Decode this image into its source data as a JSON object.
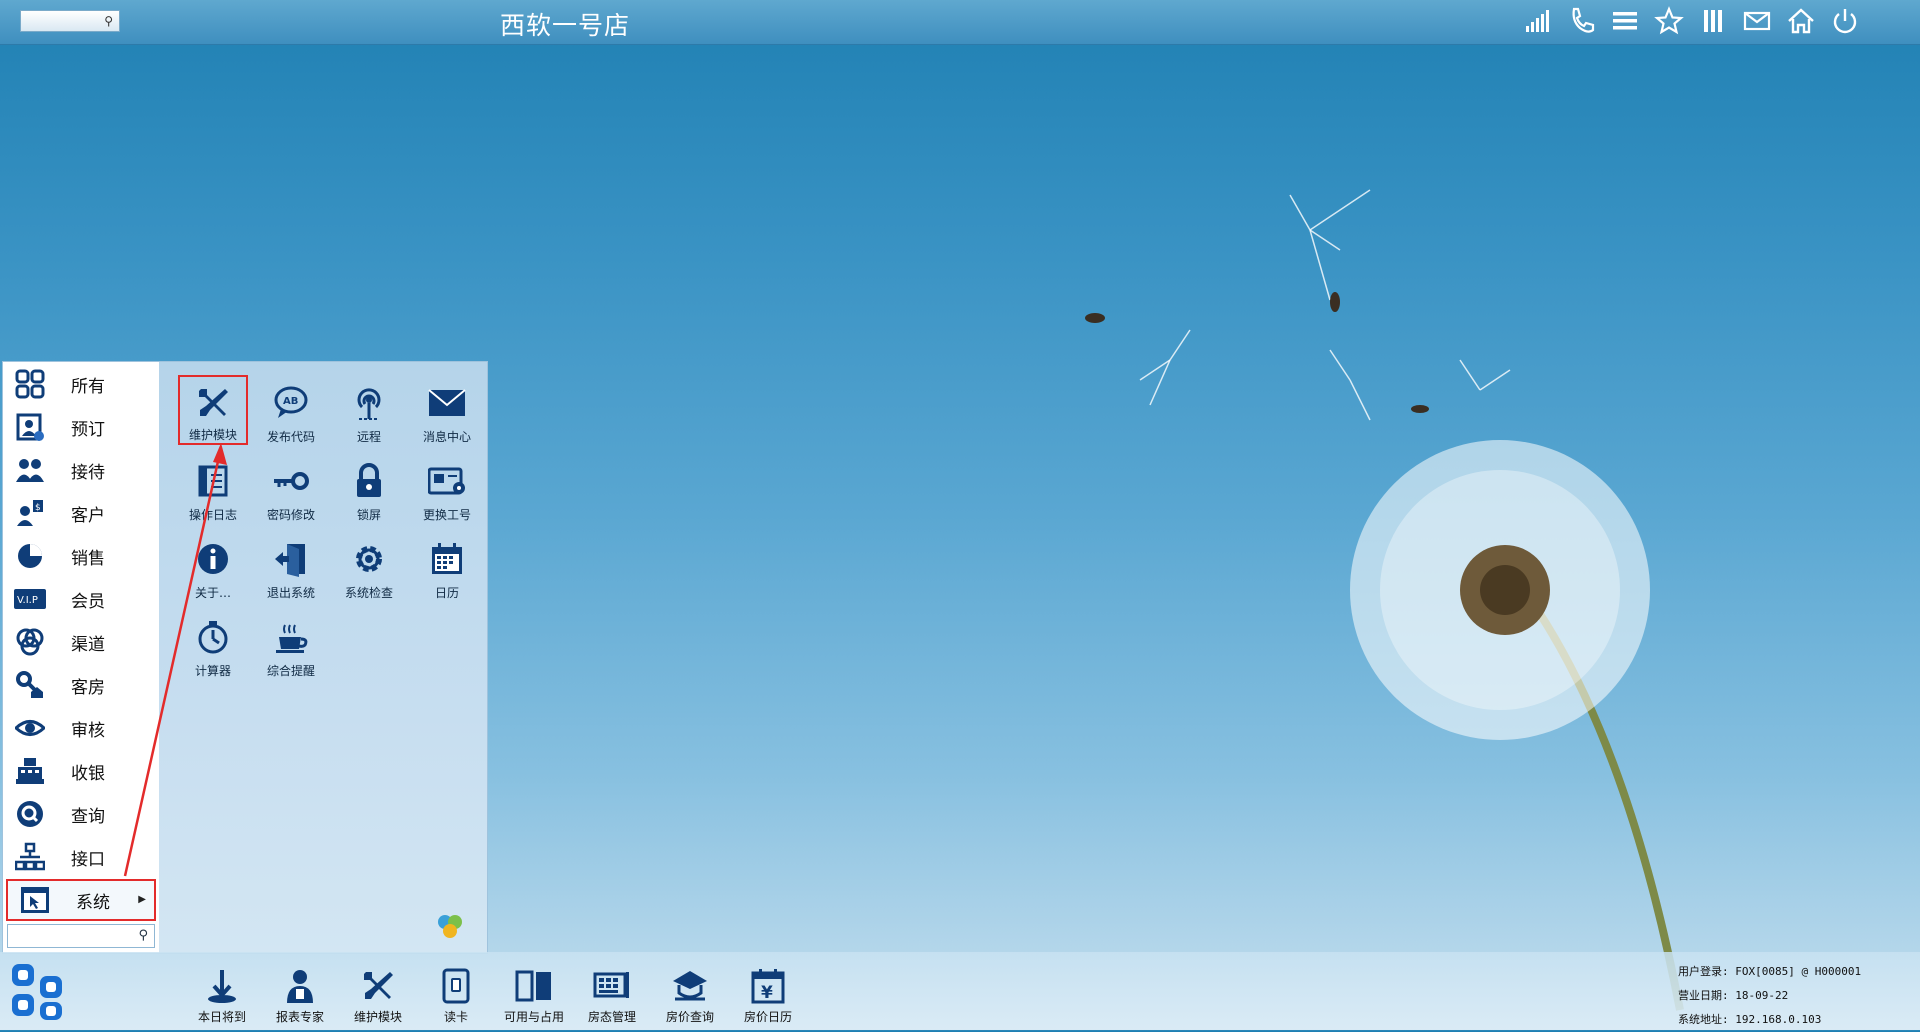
{
  "app": {
    "title": "西软一号店"
  },
  "top_search": {
    "placeholder": ""
  },
  "top_icons": [
    {
      "name": "signal-icon"
    },
    {
      "name": "phone-icon"
    },
    {
      "name": "menu-list-icon"
    },
    {
      "name": "star-icon"
    },
    {
      "name": "columns-icon"
    },
    {
      "name": "mail-icon"
    },
    {
      "name": "home-icon"
    },
    {
      "name": "power-icon"
    }
  ],
  "menu": {
    "categories": [
      {
        "label": "所有",
        "icon": "grid-icon"
      },
      {
        "label": "预订",
        "icon": "booking-icon"
      },
      {
        "label": "接待",
        "icon": "reception-icon"
      },
      {
        "label": "客户",
        "icon": "customer-icon"
      },
      {
        "label": "销售",
        "icon": "sales-icon"
      },
      {
        "label": "会员",
        "icon": "vip-icon"
      },
      {
        "label": "渠道",
        "icon": "channel-icon"
      },
      {
        "label": "客房",
        "icon": "room-icon"
      },
      {
        "label": "审核",
        "icon": "eye-icon"
      },
      {
        "label": "收银",
        "icon": "cashier-icon"
      },
      {
        "label": "查询",
        "icon": "search-icon"
      },
      {
        "label": "接口",
        "icon": "interface-icon"
      },
      {
        "label": "系统",
        "icon": "system-icon",
        "active": true
      }
    ],
    "tiles": [
      {
        "label": "维护模块",
        "icon": "wrench-icon",
        "highlighted": true
      },
      {
        "label": "发布代码",
        "icon": "speech-code-icon"
      },
      {
        "label": "远程",
        "icon": "antenna-icon"
      },
      {
        "label": "消息中心",
        "icon": "envelope-icon"
      },
      {
        "label": "操作日志",
        "icon": "logbook-icon"
      },
      {
        "label": "密码修改",
        "icon": "key-icon"
      },
      {
        "label": "锁屏",
        "icon": "lock-icon"
      },
      {
        "label": "更换工号",
        "icon": "id-card-icon"
      },
      {
        "label": "关于…",
        "icon": "info-icon"
      },
      {
        "label": "退出系统",
        "icon": "exit-icon"
      },
      {
        "label": "系统检查",
        "icon": "gear-check-icon"
      },
      {
        "label": "日历",
        "icon": "calendar-icon"
      },
      {
        "label": "计算器",
        "icon": "stopwatch-icon"
      },
      {
        "label": "综合提醒",
        "icon": "coffee-icon"
      }
    ],
    "search_placeholder": ""
  },
  "taskbar": {
    "buttons": [
      {
        "label": "本日将到",
        "icon": "arrival-icon"
      },
      {
        "label": "报表专家",
        "icon": "report-expert-icon"
      },
      {
        "label": "维护模块",
        "icon": "wrench-icon"
      },
      {
        "label": "读卡",
        "icon": "card-reader-icon"
      },
      {
        "label": "可用与占用",
        "icon": "availability-icon"
      },
      {
        "label": "房态管理",
        "icon": "room-status-icon"
      },
      {
        "label": "房价查询",
        "icon": "rate-query-icon"
      },
      {
        "label": "房价日历",
        "icon": "rate-calendar-icon"
      }
    ],
    "status": {
      "login": "用户登录: FOX[0085] @ H000001",
      "business_date": "营业日期: 18-09-22",
      "address": "系统地址: 192.168.0.103"
    }
  },
  "colors": {
    "accent": "#0f3d78",
    "highlight": "#e32b2b"
  }
}
